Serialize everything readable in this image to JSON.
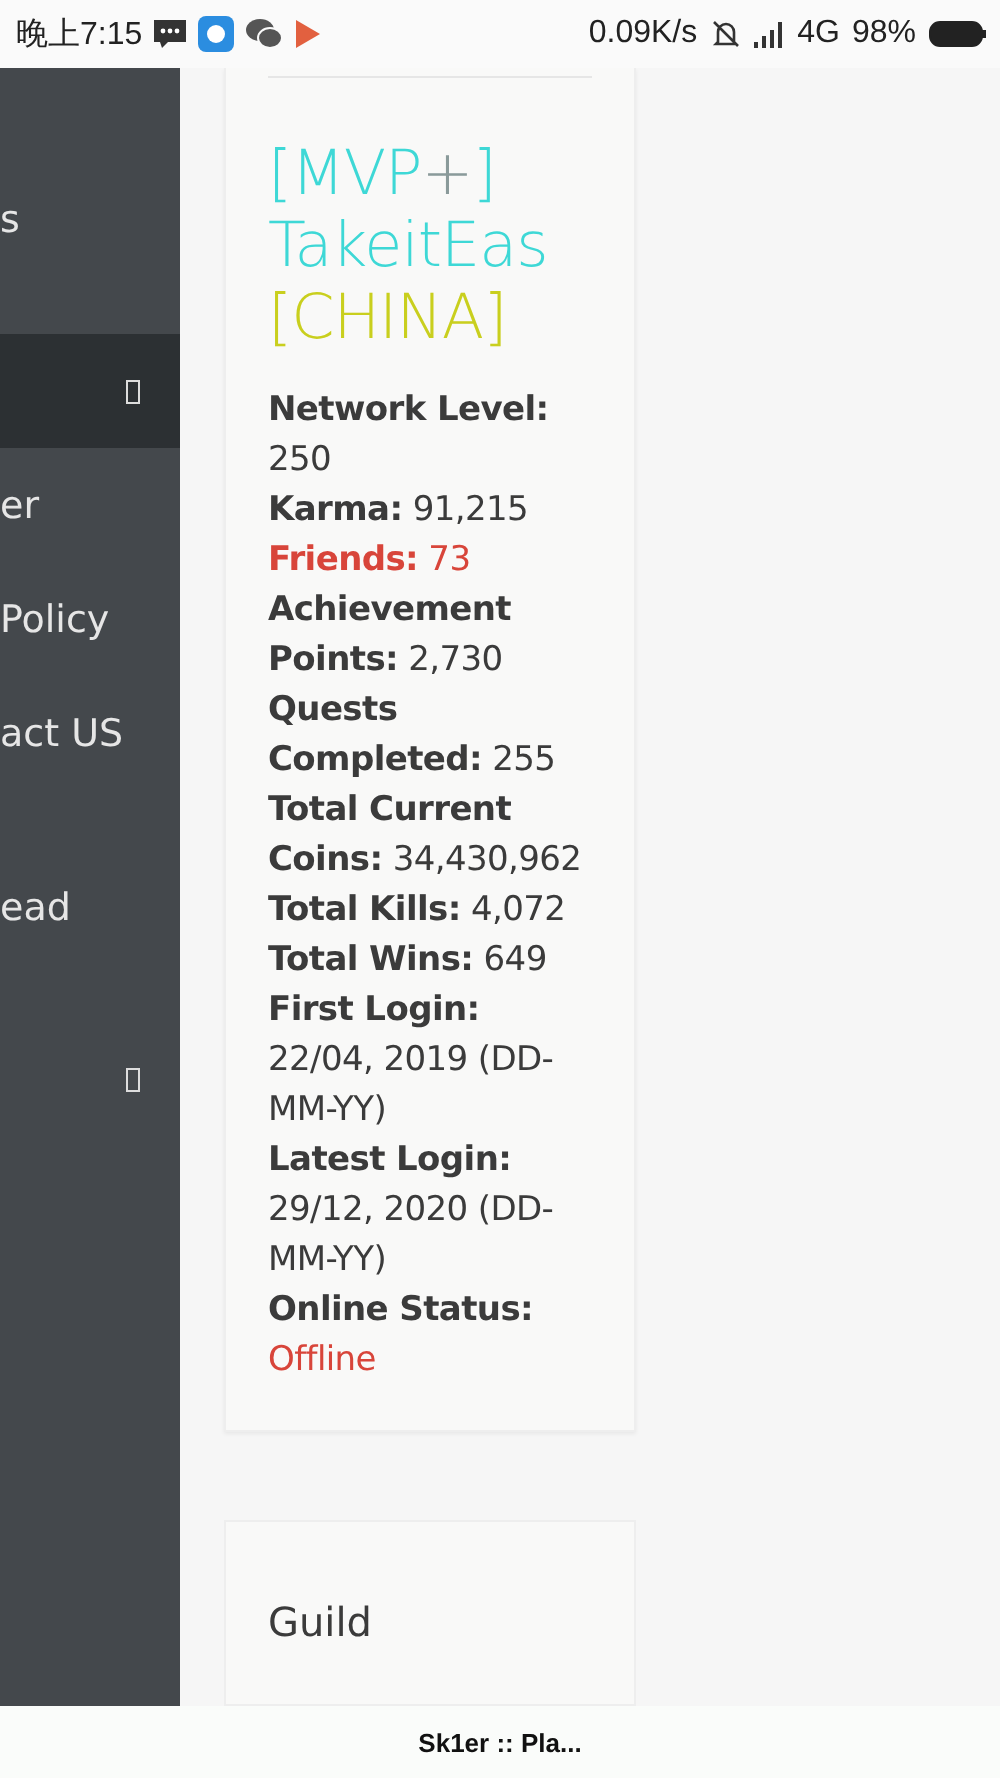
{
  "status_bar": {
    "time": "晚上7:15",
    "speed": "0.09K/s",
    "network": "4G",
    "battery": "98%"
  },
  "sidebar": {
    "items": [
      {
        "label": "s",
        "selected": false,
        "icon": false
      },
      {
        "selected": true,
        "icon": true
      },
      {
        "label": "er",
        "selected": false,
        "icon": false
      },
      {
        "label": " Policy",
        "selected": false,
        "icon": false
      },
      {
        "label": "act US",
        "selected": false,
        "icon": false
      },
      {
        "label": "ead",
        "selected": false,
        "icon": false
      },
      {
        "selected": false,
        "icon": true
      }
    ]
  },
  "player": {
    "name": [
      {
        "text": "[MVP",
        "color": "#3ed8d6"
      },
      {
        "text": "+",
        "color": "#8a9a9a"
      },
      {
        "text": "]",
        "color": "#3ed8d6"
      },
      {
        "text": " TakeitEas",
        "color": "#3ed8d6"
      },
      {
        "text": " [CHINA]",
        "color": "#c9cf1e"
      }
    ],
    "stats": [
      {
        "label": "Network Level:",
        "value": "250",
        "highlight": false
      },
      {
        "label": "Karma:",
        "value": "91,215",
        "highlight": false
      },
      {
        "label": "Friends:",
        "value": "73",
        "highlight": true
      },
      {
        "label": "Achievement Points:",
        "value": "2,730",
        "highlight": false
      },
      {
        "label": "Quests Completed:",
        "value": "255",
        "highlight": false
      },
      {
        "label": "Total Current Coins:",
        "value": "34,430,962",
        "highlight": false
      },
      {
        "label": "Total Kills:",
        "value": "4,072",
        "highlight": false
      },
      {
        "label": "Total Wins:",
        "value": "649",
        "highlight": false
      },
      {
        "label": "First Login:",
        "value": "22/04, 2019 (DD-MM-YY)",
        "highlight": false
      },
      {
        "label": "Latest Login:",
        "value": "29/12, 2020 (DD-MM-YY)",
        "highlight": false
      }
    ],
    "online_status": {
      "label": "Online Status:",
      "value": "Offline",
      "online": false
    }
  },
  "guild": {
    "title": "Guild"
  },
  "browser_title": "Sk1er :: Pla..."
}
